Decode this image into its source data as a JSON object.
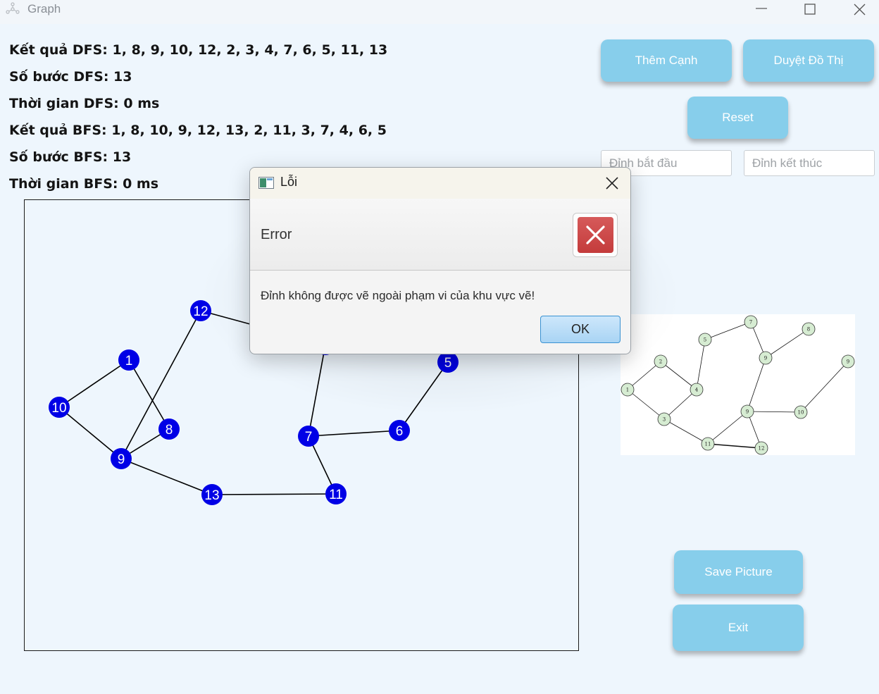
{
  "window": {
    "title": "Graph",
    "icons": [
      "app-graph-icon",
      "minimize-icon",
      "maximize-icon",
      "close-icon"
    ]
  },
  "results": {
    "dfs_result": "Kết quả DFS: 1, 8, 9, 10, 12, 2, 3, 4, 7, 6, 5, 11, 13",
    "dfs_steps": "Số bước DFS: 13",
    "dfs_time": "Thời gian DFS: 0 ms",
    "bfs_result": "Kết quả BFS: 1, 8, 10, 9, 12, 13, 2, 11, 3, 7, 4, 6, 5",
    "bfs_steps": "Số bước BFS: 13",
    "bfs_time": "Thời gian BFS: 0 ms"
  },
  "buttons": {
    "add_edge": "Thêm Cạnh",
    "traverse": "Duyệt Đồ Thị",
    "reset": "Reset",
    "save_picture": "Save Picture",
    "exit": "Exit"
  },
  "inputs": {
    "start_vertex_placeholder": "Đỉnh bắt đầu",
    "end_vertex_placeholder": "Đỉnh kết thúc"
  },
  "colors": {
    "button": "#87ceeb",
    "node": "#0000e6",
    "preview_node": "#d6ecd2",
    "error": "#c94444"
  },
  "graph": {
    "nodes": [
      {
        "id": "1",
        "label": "1"
      },
      {
        "id": "5",
        "label": "5"
      },
      {
        "id": "6",
        "label": "6"
      },
      {
        "id": "7",
        "label": "7"
      },
      {
        "id": "8",
        "label": "8"
      },
      {
        "id": "9",
        "label": "9"
      },
      {
        "id": "10",
        "label": "10"
      },
      {
        "id": "11",
        "label": "11"
      },
      {
        "id": "12",
        "label": "12"
      },
      {
        "id": "13",
        "label": "13"
      },
      {
        "id": "2",
        "label": ""
      }
    ],
    "edges": [
      [
        "1",
        "10"
      ],
      [
        "1",
        "8"
      ],
      [
        "10",
        "9"
      ],
      [
        "9",
        "8"
      ],
      [
        "9",
        "12"
      ],
      [
        "9",
        "13"
      ],
      [
        "13",
        "11"
      ],
      [
        "11",
        "7"
      ],
      [
        "7",
        "6"
      ],
      [
        "6",
        "5"
      ],
      [
        "7",
        "2"
      ],
      [
        "12",
        "2"
      ]
    ]
  },
  "preview": {
    "nodes": [
      "1",
      "2",
      "3",
      "4",
      "5",
      "7",
      "8",
      "9",
      "9",
      "9",
      "10",
      "11",
      "12"
    ],
    "edges_count": 14
  },
  "dialog": {
    "title": "Lỗi",
    "header": "Error",
    "message": "Đỉnh không được vẽ ngoài phạm vi của khu vực vẽ!",
    "ok_label": "OK",
    "icons": [
      "dialog-window-icon",
      "dialog-close-icon",
      "error-icon"
    ]
  }
}
